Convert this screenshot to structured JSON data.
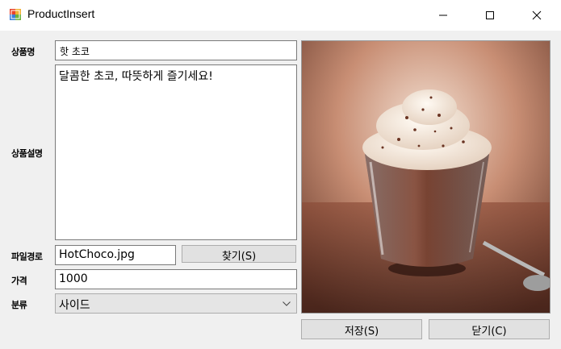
{
  "window": {
    "title": "ProductInsert"
  },
  "form": {
    "name_label": "상품명",
    "name_value": "핫 초코",
    "desc_label": "상품설명",
    "desc_value": "달콤한 초코, 따뜻하게 즐기세요!",
    "path_label": "파일경로",
    "path_value": "HotChoco.jpg",
    "browse_button": "찾기(S)",
    "price_label": "가격",
    "price_value": "1000",
    "category_label": "분류",
    "category_value": "사이드"
  },
  "actions": {
    "save_button": "저장(S)",
    "close_button": "닫기(C)"
  },
  "image": {
    "subject": "hot chocolate with whipped cream in glass cup"
  },
  "colors": {
    "window_bg": "#f0f0f0",
    "titlebar_bg": "#ffffff",
    "button_bg": "#e1e1e1"
  }
}
